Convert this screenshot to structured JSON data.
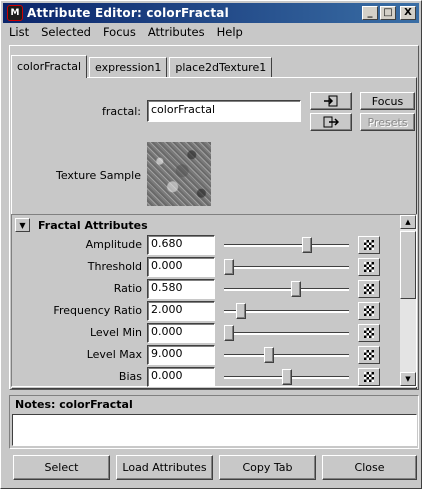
{
  "window": {
    "title": "Attribute Editor: colorFractal",
    "app_icon_label": "M",
    "controls": {
      "minimize": "_",
      "maximize": "□",
      "close": "X"
    }
  },
  "menubar": [
    "List",
    "Selected",
    "Focus",
    "Attributes",
    "Help"
  ],
  "tabs": [
    {
      "label": "colorFractal",
      "active": true
    },
    {
      "label": "expression1",
      "active": false
    },
    {
      "label": "place2dTexture1",
      "active": false
    }
  ],
  "node": {
    "label": "fractal:",
    "value": "colorFractal",
    "focus_label": "Focus",
    "presets_label": "Presets",
    "input_conn_icon": "input-connection-icon",
    "output_conn_icon": "output-connection-icon"
  },
  "texture_sample": {
    "label": "Texture Sample"
  },
  "section": {
    "title": "Fractal Attributes",
    "collapse_icon": "triangle-down-icon",
    "rows": [
      {
        "label": "Amplitude",
        "value": "0.680",
        "slider": 0.68
      },
      {
        "label": "Threshold",
        "value": "0.000",
        "slider": 0.0
      },
      {
        "label": "Ratio",
        "value": "0.580",
        "slider": 0.58
      },
      {
        "label": "Frequency Ratio",
        "value": "2.000",
        "slider": 0.1
      },
      {
        "label": "Level Min",
        "value": "0.000",
        "slider": 0.0
      },
      {
        "label": "Level Max",
        "value": "9.000",
        "slider": 0.35
      },
      {
        "label": "Bias",
        "value": "0.000",
        "slider": 0.5
      }
    ]
  },
  "notes": {
    "title": "Notes:  colorFractal",
    "value": ""
  },
  "buttons": {
    "select": "Select",
    "load": "Load Attributes",
    "copy": "Copy Tab",
    "close": "Close"
  }
}
